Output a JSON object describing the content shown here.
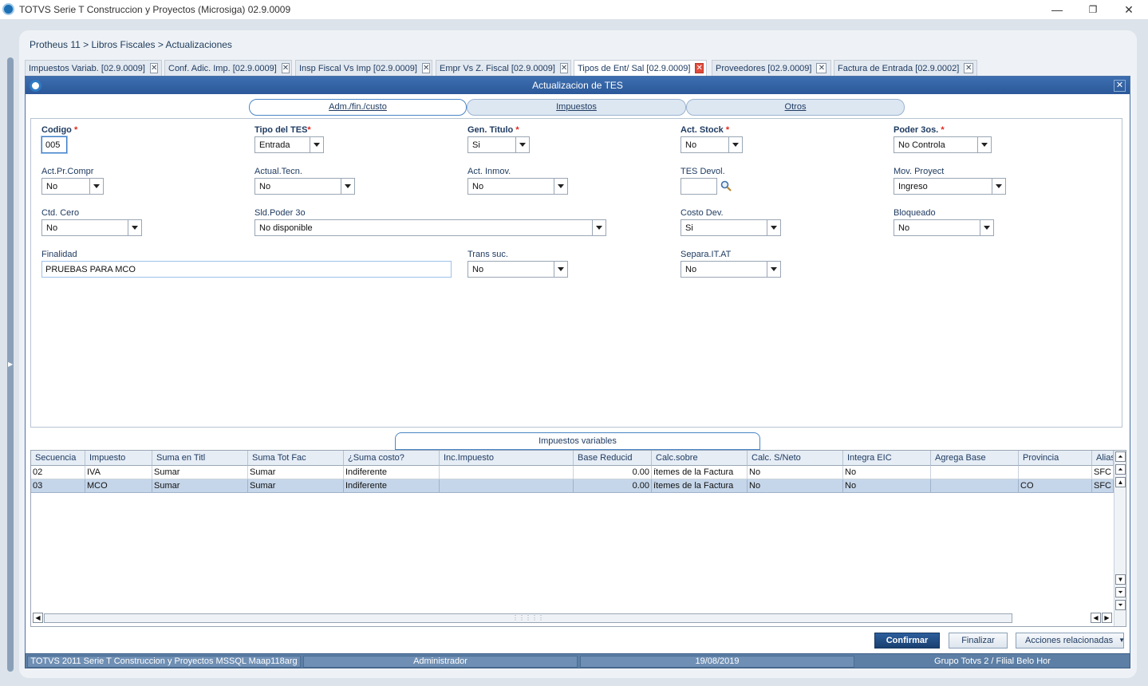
{
  "window": {
    "title": "TOTVS Serie T Construccion y Proyectos (Microsiga) 02.9.0009",
    "minimize": "—",
    "restore": "❐",
    "close": "✕"
  },
  "breadcrumb": "Protheus 11 > Libros Fiscales > Actualizaciones",
  "tabs": [
    {
      "label": "Impuestos Variab. [02.9.0009]"
    },
    {
      "label": "Conf. Adic. Imp. [02.9.0009]"
    },
    {
      "label": "Insp Fiscal Vs Imp [02.9.0009]"
    },
    {
      "label": "Empr Vs Z. Fiscal [02.9.0009]"
    },
    {
      "label": "Tipos de Ent/ Sal [02.9.0009]"
    },
    {
      "label": "Proveedores [02.9.0009]"
    },
    {
      "label": "Factura de Entrada [02.9.0002]"
    }
  ],
  "tab_close": "✕",
  "dialog": {
    "title": "Actualizacion de TES",
    "close": "✕",
    "folder_tabs": [
      "Adm./fin./custo",
      "Impuestos",
      "Otros"
    ]
  },
  "form": {
    "codigo": {
      "label": "Codigo",
      "value": "005"
    },
    "tipo_tes": {
      "label": "Tipo del TES",
      "value": "Entrada"
    },
    "gen_titulo": {
      "label": "Gen. Titulo",
      "value": "Si"
    },
    "act_stock": {
      "label": "Act. Stock",
      "value": "No"
    },
    "poder_3os": {
      "label": "Poder 3os.",
      "value": "No Controla"
    },
    "act_pr_compr": {
      "label": "Act.Pr.Compr",
      "value": "No"
    },
    "actual_tecn": {
      "label": "Actual.Tecn.",
      "value": "No"
    },
    "act_inmov": {
      "label": "Act. Inmov.",
      "value": "No"
    },
    "tes_devol": {
      "label": "TES Devol.",
      "value": ""
    },
    "mov_proyect": {
      "label": "Mov. Proyect",
      "value": "Ingreso"
    },
    "ctd_cero": {
      "label": "Ctd. Cero",
      "value": "No"
    },
    "sld_poder_3o": {
      "label": "Sld.Poder 3o",
      "value": "No disponible"
    },
    "costo_dev": {
      "label": "Costo Dev.",
      "value": "Si"
    },
    "bloqueado": {
      "label": "Bloqueado",
      "value": "No"
    },
    "finalidad": {
      "label": "Finalidad",
      "value": "PRUEBAS PARA MCO"
    },
    "trans_suc": {
      "label": "Trans suc.",
      "value": "No"
    },
    "separa_it_at": {
      "label": "Separa.IT.AT",
      "value": "No"
    },
    "required_mark": "*"
  },
  "grid": {
    "title": "Impuestos variables",
    "columns": [
      "Secuencia",
      "Impuesto",
      "Suma en Titl",
      "Suma Tot Fac",
      "¿Suma costo?",
      "Inc.Impuesto",
      "Base Reducid",
      "Calc.sobre",
      "Calc. S/Neto",
      "Integra EIC",
      "Agrega Base",
      "Provincia",
      "Alias"
    ],
    "rows": [
      [
        "02",
        "IVA",
        "Sumar",
        "Sumar",
        "Indiferente",
        "",
        "0.00",
        "ítemes de la Factura",
        "No",
        "No",
        "",
        "",
        "SFC"
      ],
      [
        "03",
        "MCO",
        "Sumar",
        "Sumar",
        "Indiferente",
        "",
        "0.00",
        "ítemes de la Factura",
        "No",
        "No",
        "",
        "CO",
        "SFC"
      ]
    ],
    "selected_row": 1
  },
  "buttons": {
    "confirm": "Confirmar",
    "finish": "Finalizar",
    "related": "Acciones relacionadas"
  },
  "status": {
    "product": "TOTVS 2011 Serie T Construccion y Proyectos MSSQL Maap118arg",
    "user": "Administrador",
    "date": "19/08/2019",
    "company": "Grupo Totvs 2 / Filial Belo Hor"
  }
}
